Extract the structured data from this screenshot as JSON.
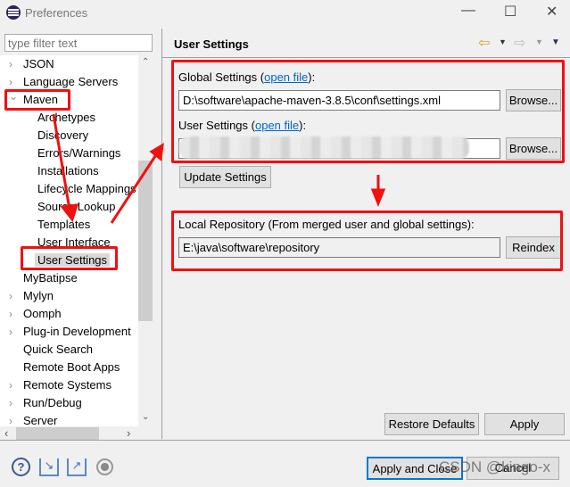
{
  "window": {
    "title": "Preferences",
    "minimize": "—",
    "maximize": "☐",
    "close": "✕"
  },
  "filter": {
    "placeholder": "type filter text"
  },
  "tree": {
    "items": [
      {
        "label": "JSON",
        "level": 0,
        "expandable": true
      },
      {
        "label": "Language Servers",
        "level": 0,
        "expandable": true
      },
      {
        "label": "Maven",
        "level": 0,
        "expandable": true,
        "expanded": true
      },
      {
        "label": "Archetypes",
        "level": 1
      },
      {
        "label": "Discovery",
        "level": 1
      },
      {
        "label": "Errors/Warnings",
        "level": 1
      },
      {
        "label": "Installations",
        "level": 1
      },
      {
        "label": "Lifecycle Mappings",
        "level": 1
      },
      {
        "label": "Source Lookup",
        "level": 1
      },
      {
        "label": "Templates",
        "level": 1
      },
      {
        "label": "User Interface",
        "level": 1
      },
      {
        "label": "User Settings",
        "level": 1,
        "selected": true
      },
      {
        "label": "MyBatipse",
        "level": 0
      },
      {
        "label": "Mylyn",
        "level": 0,
        "expandable": true
      },
      {
        "label": "Oomph",
        "level": 0,
        "expandable": true
      },
      {
        "label": "Plug-in Development",
        "level": 0,
        "expandable": true
      },
      {
        "label": "Quick Search",
        "level": 0
      },
      {
        "label": "Remote Boot Apps",
        "level": 0
      },
      {
        "label": "Remote Systems",
        "level": 0,
        "expandable": true
      },
      {
        "label": "Run/Debug",
        "level": 0,
        "expandable": true
      },
      {
        "label": "Server",
        "level": 0,
        "expandable": true
      }
    ]
  },
  "page": {
    "title": "User Settings",
    "global_label": "Global Settings (",
    "global_label_end": "):",
    "user_label": "User Settings (",
    "user_label_end": "):",
    "open_file": "open file",
    "global_value": "D:\\software\\apache-maven-3.8.5\\conf\\settings.xml",
    "browse": "Browse...",
    "update": "Update Settings",
    "local_label": "Local Repository (From merged user and global settings):",
    "local_value": "E:\\java\\software\\repository",
    "reindex": "Reindex",
    "restore": "Restore Defaults",
    "apply": "Apply"
  },
  "footer": {
    "apply_close": "Apply and Close",
    "cancel": "Cancel"
  },
  "watermark": "CSDN @kingo-x",
  "colors": {
    "annotation": "#f01010",
    "link": "#0066cc",
    "focus": "#0078d7"
  }
}
